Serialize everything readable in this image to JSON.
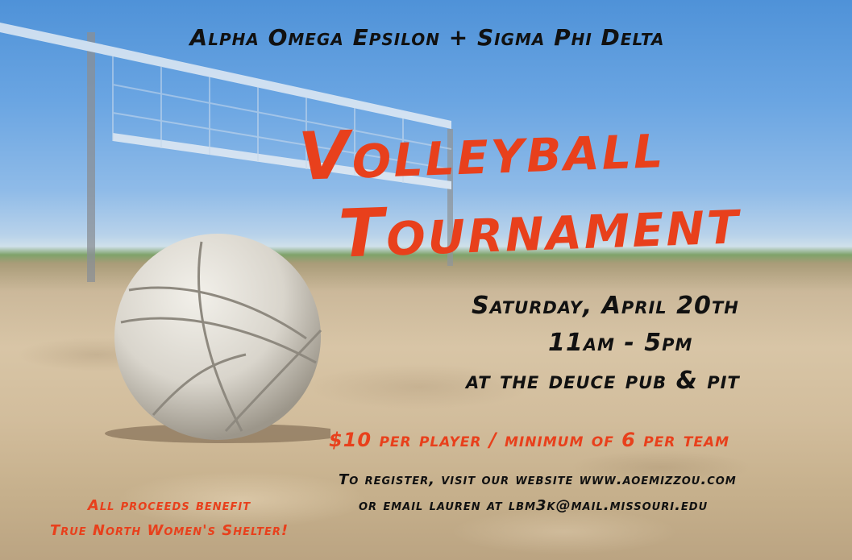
{
  "poster": {
    "header": "Alpha Omega Epsilon + Sigma Phi Delta",
    "title_line1": "Volleyball",
    "title_line2": "Tournament",
    "date": "Saturday, April 20th",
    "time": "11am - 5pm",
    "location": "at the deuce pub & pit",
    "price": "$10 per player / minimum of 6 per team",
    "register_line1": "To register, visit our website www.aoemizzou.com",
    "register_line2": "or email lauren at lbm3k@mail.missouri.edu",
    "benefit_line1": "All proceeds benefit",
    "benefit_line2": "True North Women's Shelter!"
  },
  "colors": {
    "accent": "#e8401c",
    "text": "#111111",
    "sky": "#5a9ad8",
    "sand": "#d4c1a2"
  }
}
